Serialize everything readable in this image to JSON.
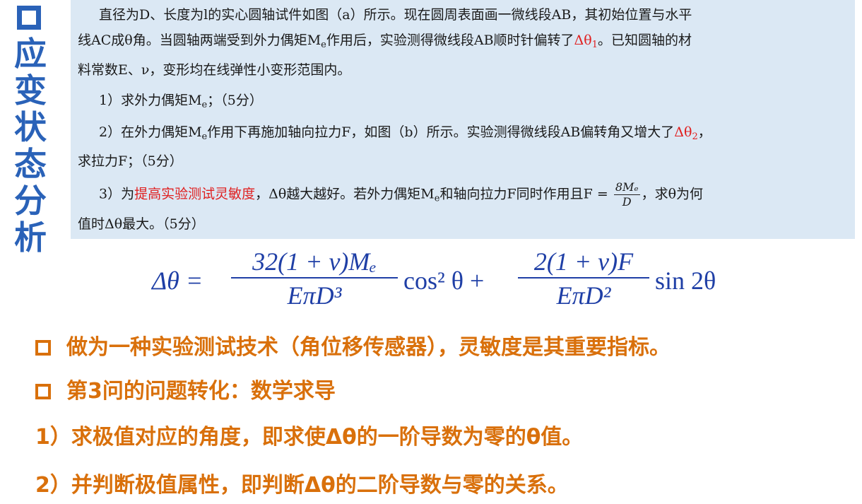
{
  "sidebar": {
    "title_chars": [
      "应",
      "变",
      "状",
      "态",
      "分",
      "析"
    ]
  },
  "problem": {
    "line1": "直径为D、长度为l的实心圆轴试件如图（a）所示。现在圆周表面画一微线段AB，其初始位置与水平",
    "line2a": "线AC成θ角。当圆轴两端受到外力偶矩M",
    "line2b": "e",
    "line2c": "作用后，实验测得微线段AB顺时针偏转了",
    "line2red": "Δθ",
    "line2redsub": "1",
    "line2d": "。已知圆轴的材",
    "line3": "料常数E、ν，变形均在线弹性小变形范围内。",
    "q1a": "1）求外力偶矩M",
    "q1sub": "e",
    "q1b": "；（5分）",
    "q2a": "2）在外力偶矩M",
    "q2sub": "e",
    "q2b": "作用下再施加轴向拉力F，如图（b）所示。实验测得微线段AB偏转角又增大了",
    "q2red": "Δθ",
    "q2redsub": "2",
    "q2c": "，",
    "q2line2": "求拉力F；（5分）",
    "q3a": "3）为",
    "q3red": "提高实验测试灵敏度",
    "q3b": "，Δθ越大越好。若外力偶矩M",
    "q3sub": "e",
    "q3c": "和轴向拉力F同时作用且F =",
    "q3num": "8Mₑ",
    "q3den": "D",
    "q3d": "，求θ为何",
    "q3line2": "值时Δθ最大。（5分）"
  },
  "formula": {
    "lhs": "Δθ =",
    "f1num": "32(1 + ν)Mₑ",
    "f1den": "EπD³",
    "t1": "cos² θ +",
    "f2num": "2(1 + ν)F",
    "f2den": "EπD²",
    "t2": "sin 2θ"
  },
  "bullets": {
    "b1": "做为一种实验测试技术（角位移传感器），灵敏度是其重要指标。",
    "b2": "第3问的问题转化：数学求导",
    "s1": "1）求极值对应的角度，即求使Δθ的一阶导数为零的θ值。",
    "s2": "2）并判断极值属性，即判断Δθ的二阶导数与零的关系。"
  }
}
